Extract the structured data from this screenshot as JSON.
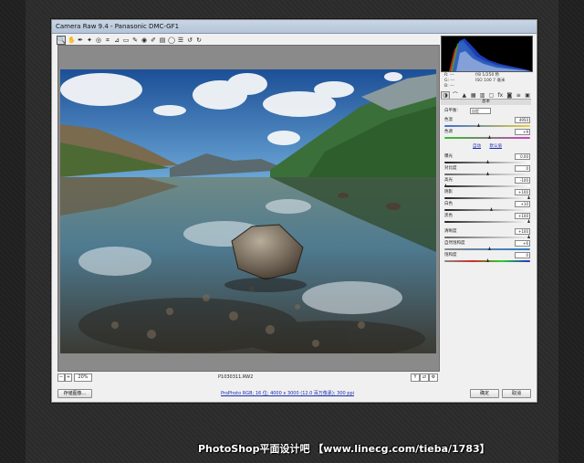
{
  "window": {
    "title": "Camera Raw 9.4  -  Panasonic DMC-GF1"
  },
  "toolbar": {
    "tools": [
      {
        "name": "zoom-tool-icon",
        "glyph": "🔍"
      },
      {
        "name": "hand-tool-icon",
        "glyph": "✋"
      },
      {
        "name": "white-balance-tool-icon",
        "glyph": "✒"
      },
      {
        "name": "color-sampler-tool-icon",
        "glyph": "✦"
      },
      {
        "name": "targeted-adjustment-tool-icon",
        "glyph": "◎"
      },
      {
        "name": "crop-tool-icon",
        "glyph": "⌗"
      },
      {
        "name": "straighten-tool-icon",
        "glyph": "⊿"
      },
      {
        "name": "transform-tool-icon",
        "glyph": "▭"
      },
      {
        "name": "spot-removal-tool-icon",
        "glyph": "✎"
      },
      {
        "name": "red-eye-tool-icon",
        "glyph": "◉"
      },
      {
        "name": "adjustment-brush-icon",
        "glyph": "✐"
      },
      {
        "name": "graduated-filter-icon",
        "glyph": "▤"
      },
      {
        "name": "radial-filter-icon",
        "glyph": "◯"
      },
      {
        "name": "preferences-icon",
        "glyph": "☰"
      },
      {
        "name": "rotate-ccw-icon",
        "glyph": "↺"
      },
      {
        "name": "rotate-cw-icon",
        "glyph": "↻"
      }
    ],
    "open_fullscreen_glyph": "⇲"
  },
  "preview": {
    "zoom": "20%",
    "filename": "P1030311.RW2"
  },
  "histogram": {
    "readout_left": [
      "R: ---",
      "G: ---",
      "B: ---"
    ],
    "readout_right": [
      "f/8  1/250 秒",
      "ISO 100  7 毫米"
    ]
  },
  "panel": {
    "section_title": "基本",
    "white_balance_label": "白平衡:",
    "white_balance_value": "自定",
    "temp_label": "色温",
    "temp_value": "4950",
    "tint_label": "色调",
    "tint_value": "+9",
    "auto_link": "自动",
    "default_link": "默认值",
    "sliders": [
      {
        "label": "曝光",
        "value": "0.00",
        "pos": 0.5,
        "grad": "linear-gradient(90deg,#222,#fff)"
      },
      {
        "label": "对比度",
        "value": "0",
        "pos": 0.5,
        "grad": "linear-gradient(90deg,#666,#eee)"
      },
      {
        "label": "高光",
        "value": "-100",
        "pos": 0.0,
        "grad": "linear-gradient(90deg,#222,#fff)"
      },
      {
        "label": "阴影",
        "value": "+100",
        "pos": 1.0,
        "grad": "linear-gradient(90deg,#222,#fff)"
      },
      {
        "label": "白色",
        "value": "+10",
        "pos": 0.55,
        "grad": "linear-gradient(90deg,#222,#fff)"
      },
      {
        "label": "黑色",
        "value": "+100",
        "pos": 1.0,
        "grad": "linear-gradient(90deg,#222,#fff)"
      },
      {
        "label": "清晰度",
        "value": "+100",
        "pos": 1.0,
        "grad": "linear-gradient(90deg,#666,#eee)"
      },
      {
        "label": "自然饱和度",
        "value": "+6",
        "pos": 0.53,
        "grad": "linear-gradient(90deg,#888,#2a7fd0)"
      },
      {
        "label": "饱和度",
        "value": "0",
        "pos": 0.5,
        "grad": "linear-gradient(90deg,#888,#d02a2a,#2ad02a,#2a2ad0)"
      }
    ]
  },
  "bottom": {
    "save_label": "存储图像...",
    "workflow_link": "ProPhoto RGB; 16 位; 4000 x 3000 (12.0 百万像素); 300 ppi",
    "ok_label": "确定",
    "cancel_label": "取消"
  },
  "watermark": "PhotoShop平面设计吧  【www.linecg.com/tieba/1783】",
  "colors": {
    "accent": "#1a2db0",
    "window_bg": "#f0f0f0",
    "page_bg": "#2e2e2e"
  }
}
